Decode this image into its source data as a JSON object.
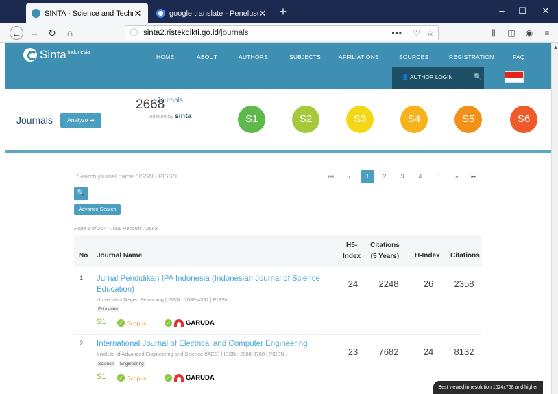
{
  "browser": {
    "tabs": [
      {
        "title": "SINTA - Science and Technolog",
        "close": "✕"
      },
      {
        "title": "google translate - Penelusuran",
        "close": "✕"
      }
    ],
    "new_tab": "+",
    "url_host": "sinta2.ristekdikti.go.id",
    "url_path": "/journals",
    "url_dots": "•••"
  },
  "site": {
    "logo_name": "Sinta",
    "logo_sup": "Indonesia",
    "menu": [
      "HOME",
      "ABOUT",
      "AUTHORS",
      "SUBJECTS",
      "AFFILIATIONS",
      "SOURCES",
      "REGISTRATION",
      "FAQ"
    ],
    "login_label": "AUTHOR LOGIN"
  },
  "stats": {
    "page_title": "Journals",
    "analyze_label": "Analyze",
    "count": "2668",
    "count_label": "Journals",
    "indexed_by": "indexed by",
    "indexed_brand": "sinta",
    "badges": [
      {
        "label": "S1",
        "color": "#5cb94a"
      },
      {
        "label": "S2",
        "color": "#a5c93a"
      },
      {
        "label": "S3",
        "color": "#f4d816"
      },
      {
        "label": "S4",
        "color": "#f7b21c"
      },
      {
        "label": "S5",
        "color": "#f39019"
      },
      {
        "label": "S6",
        "color": "#ef5a28"
      }
    ]
  },
  "search": {
    "placeholder": "Search journal name / ISSN / PISSN ...",
    "advanced_label": "Advance Search"
  },
  "pagination": {
    "first": "⏮",
    "prev": "«",
    "pages": [
      "1",
      "2",
      "3",
      "4",
      "5"
    ],
    "next": "»",
    "last": "⏭"
  },
  "records": "Page 1 of 267 | Total Records : 2668",
  "table": {
    "headers": {
      "no": "No",
      "name": "Journal Name",
      "h5_line1": "H5-",
      "h5_line2": "Index",
      "c5_line1": "Citations",
      "c5_line2": "(5 Years)",
      "hindex": "H-Index",
      "citations": "Citations"
    },
    "rows": [
      {
        "no": "1",
        "name": "Jurnal Pendidikan IPA Indonesia (Indonesian Journal of Science Education)",
        "affiliation": "Universitas Negeri Semarang | ISSN : 2089-4392 | PISSN :",
        "tags": [
          "Education"
        ],
        "rank": "S1",
        "scopus": "Scopus",
        "garuda": "GARUDA",
        "h5": "24",
        "c5": "2248",
        "hindex": "26",
        "citations": "2358"
      },
      {
        "no": "2",
        "name": "International Journal of Electrical and Computer Engineering",
        "affiliation": "Institute of Advanced Engineering and Science (IAES) | ISSN : 2088-8708 | PISSN :",
        "tags": [
          "Science",
          "Engineering"
        ],
        "rank": "S1",
        "scopus": "Scopus",
        "garuda": "GARUDA",
        "h5": "23",
        "c5": "7682",
        "hindex": "24",
        "citations": "8132"
      }
    ]
  },
  "footer_note": "Best viewed in resolution 1024x768 and higher"
}
